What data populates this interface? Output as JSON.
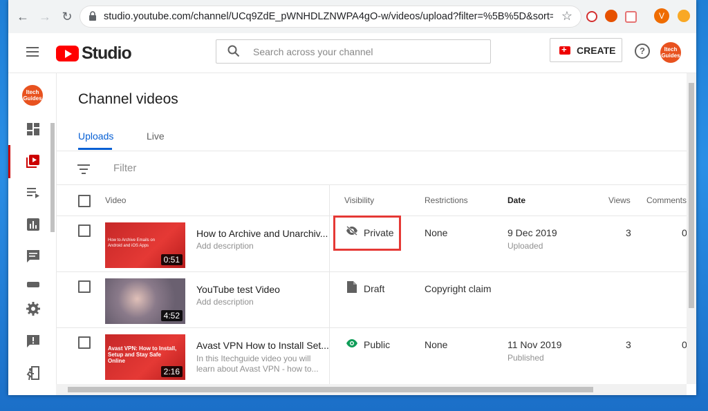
{
  "browser": {
    "url": "studio.youtube.com/channel/UCq9ZdE_pWNHDLZNWPA4gO-w/videos/upload?filter=%5B%5D&sort=%7...",
    "profile_initial": "V"
  },
  "header": {
    "logo_text": "Studio",
    "search_placeholder": "Search across your channel",
    "create_label": "CREATE",
    "help_glyph": "?",
    "avatar_text": "Itech Guides"
  },
  "rail": {
    "avatar_text": "Itech Guides",
    "icons": [
      "dashboard-icon",
      "videos-icon",
      "playlists-icon",
      "analytics-icon",
      "comments-icon",
      "subtitles-icon",
      "settings-icon",
      "feedback-icon",
      "exit-icon"
    ]
  },
  "main": {
    "title": "Channel videos",
    "tabs": [
      {
        "label": "Uploads",
        "active": true
      },
      {
        "label": "Live",
        "active": false
      }
    ],
    "filter_placeholder": "Filter",
    "columns": {
      "video": "Video",
      "visibility": "Visibility",
      "restrictions": "Restrictions",
      "date": "Date",
      "views": "Views",
      "comments": "Comments"
    },
    "rows": [
      {
        "title": "How to Archive and Unarchiv...",
        "desc": "Add description",
        "duration": "0:51",
        "thumb_text": "How to Archive Emails on Android and iOS Apps",
        "visibility": "Private",
        "restrictions": "None",
        "date": "9 Dec 2019",
        "date_sub": "Uploaded",
        "views": "3",
        "comments": "0"
      },
      {
        "title": "YouTube test Video",
        "desc": "Add description",
        "duration": "4:52",
        "thumb_text": "",
        "visibility": "Draft",
        "restrictions": "Copyright claim",
        "date": "",
        "date_sub": "",
        "views": "",
        "comments": ""
      },
      {
        "title": "Avast VPN How to Install Set...",
        "desc": "In this Itechguide video you will learn about Avast VPN - how to...",
        "duration": "2:16",
        "thumb_text": "Avast VPN: How to Install, Setup and Stay Safe Online",
        "visibility": "Public",
        "restrictions": "None",
        "date": "11 Nov 2019",
        "date_sub": "Published",
        "views": "3",
        "comments": "0"
      }
    ]
  },
  "colors": {
    "accent": "#065fd4",
    "youtube_red": "#ff0000",
    "highlight_box": "#e53935",
    "public_green": "#0f9d58"
  }
}
